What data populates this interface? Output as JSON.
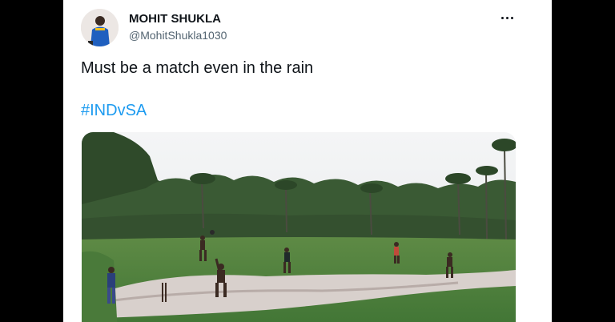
{
  "tweet": {
    "author_name": "MOHIT SHUKLA",
    "author_handle": "@MohitShukla1030",
    "text": "Must be a match even in the rain",
    "hashtag": "#INDvSA"
  },
  "icons": {
    "more": "more-options-icon"
  },
  "colors": {
    "page_background": "#000000",
    "card_background": "#ffffff",
    "hashtag": "#1d9bf0",
    "text_primary": "#0f1419",
    "text_secondary": "#536471"
  }
}
